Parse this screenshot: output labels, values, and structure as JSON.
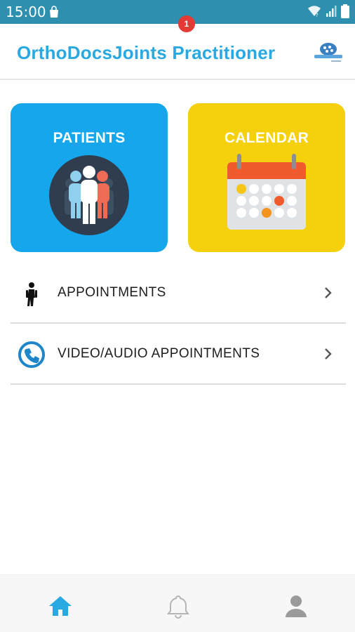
{
  "status_bar": {
    "time": "15:00",
    "icons": [
      "shopping-bag-icon",
      "wifi-icon",
      "signal-icon",
      "battery-icon"
    ]
  },
  "app_bar": {
    "title": "OrthoDocsJoints Practitioner",
    "title_color": "#29a9e1",
    "logo": "brand-logo-icon"
  },
  "tiles": [
    {
      "label": "PATIENTS",
      "color": "#16a6ec",
      "icon": "patients-group-icon"
    },
    {
      "label": "CALENDAR",
      "color": "#f5d00d",
      "icon": "calendar-icon"
    }
  ],
  "menu": [
    {
      "label": "APPOINTMENTS",
      "icon": "walking-person-icon"
    },
    {
      "label": "VIDEO/AUDIO APPOINTMENTS",
      "icon": "phone-call-icon"
    }
  ],
  "bottom_nav": {
    "items": [
      "home-icon",
      "bell-icon",
      "profile-icon"
    ],
    "active": "home-icon",
    "active_color": "#29a9e1",
    "notification_count": "1",
    "badge_color": "#e53935"
  },
  "colors": {
    "status_bar": "#2e8fae",
    "divider": "#dcdcdc"
  }
}
